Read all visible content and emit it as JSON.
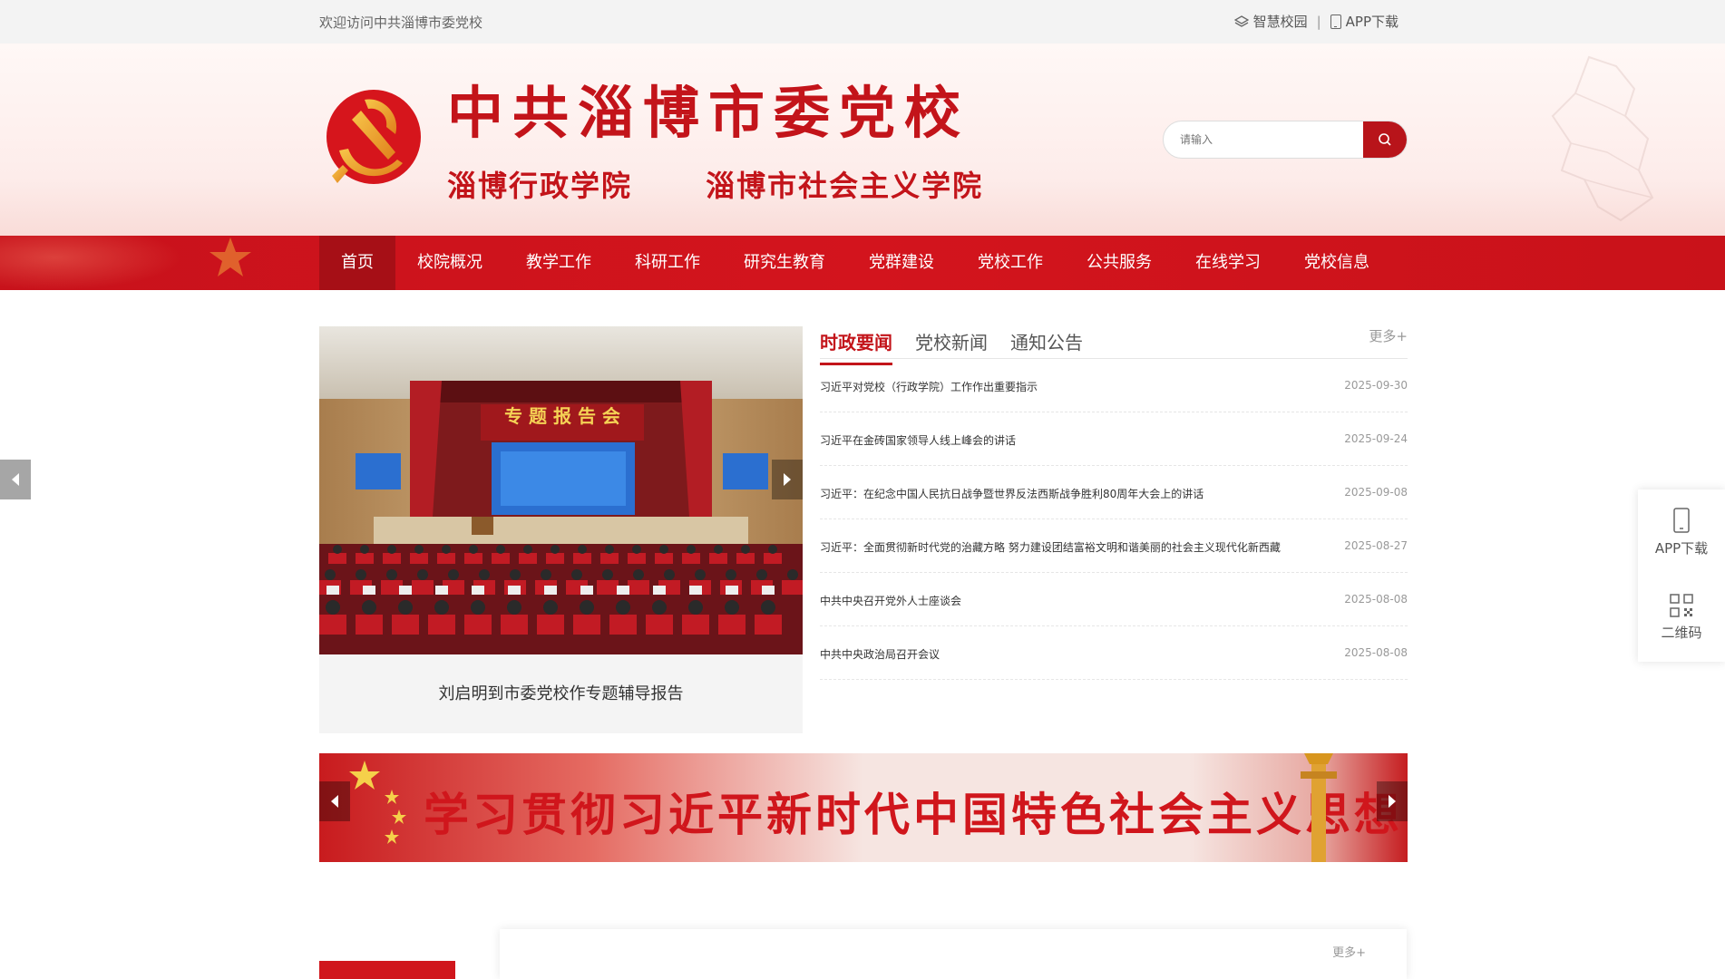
{
  "topbar": {
    "welcome": "欢迎访问中共淄博市委党校",
    "link_campus": "智慧校园",
    "separator": "|",
    "link_app": "APP下载"
  },
  "header": {
    "title": "中共淄博市委党校",
    "subtitle_left": "淄博行政学院",
    "subtitle_right": "淄博市社会主义学院",
    "search_placeholder": "请输入",
    "accent_color": "#c3141a"
  },
  "nav": {
    "items": [
      {
        "label": "首页",
        "active": true
      },
      {
        "label": "校院概况"
      },
      {
        "label": "教学工作"
      },
      {
        "label": "科研工作"
      },
      {
        "label": "研究生教育"
      },
      {
        "label": "党群建设"
      },
      {
        "label": "党校工作"
      },
      {
        "label": "公共服务"
      },
      {
        "label": "在线学习"
      },
      {
        "label": "党校信息"
      }
    ]
  },
  "slider": {
    "caption": "刘启明到市委党校作专题辅导报告",
    "stage_banner": "专 题 报 告 会"
  },
  "news": {
    "tabs": [
      "时政要闻",
      "党校新闻",
      "通知公告"
    ],
    "more": "更多+",
    "items": [
      {
        "title": "习近平对党校（行政学院）工作作出重要指示",
        "date": "2025-09-30"
      },
      {
        "title": "习近平在金砖国家领导人线上峰会的讲话",
        "date": "2025-09-24"
      },
      {
        "title": "习近平：在纪念中国人民抗日战争暨世界反法西斯战争胜利80周年大会上的讲话",
        "date": "2025-09-08"
      },
      {
        "title": "习近平：全面贯彻新时代党的治藏方略 努力建设团结富裕文明和谐美丽的社会主义现代化新西藏",
        "date": "2025-08-27"
      },
      {
        "title": "中共中央召开党外人士座谈会",
        "date": "2025-08-08"
      },
      {
        "title": "中共中央政治局召开会议",
        "date": "2025-08-08"
      }
    ]
  },
  "banner": {
    "text": "学习贯彻习近平新时代中国特色社会主义思想"
  },
  "lower": {
    "more": "更多+"
  },
  "side_panel": {
    "app_label": "APP下载",
    "qr_label": "二维码"
  }
}
